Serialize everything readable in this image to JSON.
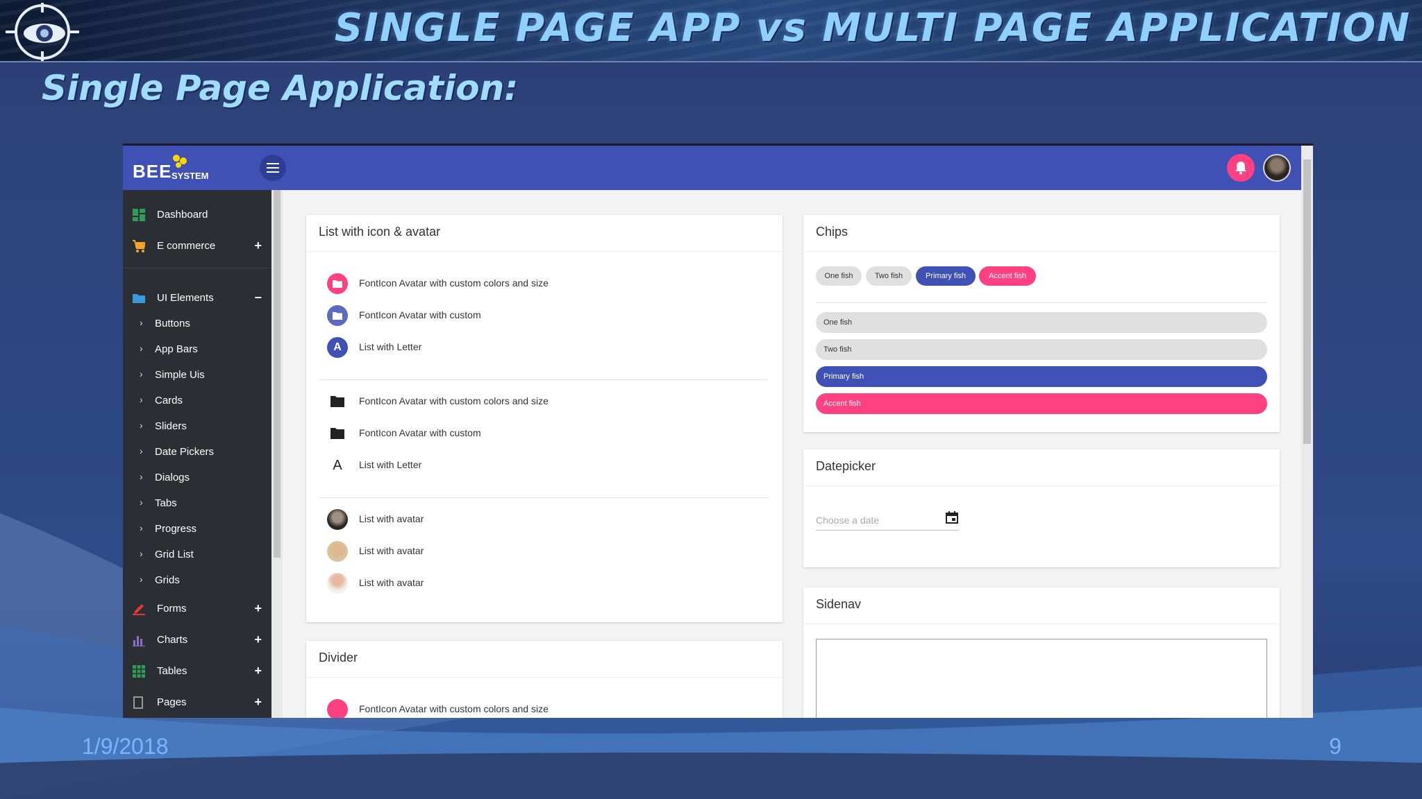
{
  "slide": {
    "title": "SINGLE PAGE APP vs MULTI PAGE APPLICATION",
    "subtitle": "Single Page Application:",
    "date": "1/9/2018",
    "page_number": "9"
  },
  "app": {
    "brand": {
      "name": "BEE",
      "tagline": "SYSTEM"
    },
    "sidebar": {
      "items": [
        {
          "label": "Dashboard",
          "icon": "dashboard-icon",
          "toggle": ""
        },
        {
          "label": "E commerce",
          "icon": "cart-icon",
          "toggle": "+"
        },
        {
          "label": "UI Elements",
          "icon": "folder-icon",
          "toggle": "−"
        },
        {
          "label": "Forms",
          "icon": "pencil-icon",
          "toggle": "+"
        },
        {
          "label": "Charts",
          "icon": "bar-chart-icon",
          "toggle": "+"
        },
        {
          "label": "Tables",
          "icon": "grid-icon",
          "toggle": "+"
        },
        {
          "label": "Pages",
          "icon": "page-icon",
          "toggle": "+"
        }
      ],
      "sub_items": [
        "Buttons",
        "App Bars",
        "Simple Uis",
        "Cards",
        "Sliders",
        "Date Pickers",
        "Dialogs",
        "Tabs",
        "Progress",
        "Grid List",
        "Grids"
      ]
    },
    "list_card": {
      "title": "List with icon & avatar",
      "group1": [
        {
          "text": "FontIcon Avatar with custom colors and size",
          "avatar": "folder-icon",
          "color": "#ff4081"
        },
        {
          "text": "FontIcon Avatar with custom",
          "avatar": "folder-icon",
          "color": "#3f51b5"
        },
        {
          "text": "List with Letter",
          "avatar": "A",
          "color": "#3f51b5"
        }
      ],
      "group2": [
        {
          "text": "FontIcon Avatar with custom colors and size",
          "avatar": "folder-icon"
        },
        {
          "text": "FontIcon Avatar with custom",
          "avatar": "folder-icon"
        },
        {
          "text": "List with Letter",
          "avatar": "A"
        }
      ],
      "group3": [
        {
          "text": "List with avatar",
          "avatar": "photo-avatar"
        },
        {
          "text": "List with avatar",
          "avatar": "photo-avatar"
        },
        {
          "text": "List with avatar",
          "avatar": "photo-avatar"
        }
      ]
    },
    "divider_card": {
      "title": "Divider",
      "first_item": "FontIcon Avatar with custom colors and size"
    },
    "chips_card": {
      "title": "Chips",
      "inline_chips": [
        "One fish",
        "Two fish",
        "Primary fish",
        "Accent fish"
      ],
      "stacked_chips": [
        "One fish",
        "Two fish",
        "Primary fish",
        "Accent fish"
      ],
      "colors": {
        "default": "#e0e0e0",
        "primary": "#3f51b5",
        "accent": "#ff4081"
      }
    },
    "datepicker_card": {
      "title": "Datepicker",
      "placeholder": "Choose a date"
    },
    "sidenav_card": {
      "title": "Sidenav"
    },
    "colors": {
      "toolbar": "#3f51b5",
      "sidebar": "#2b2f33",
      "accent": "#ff4081"
    }
  }
}
